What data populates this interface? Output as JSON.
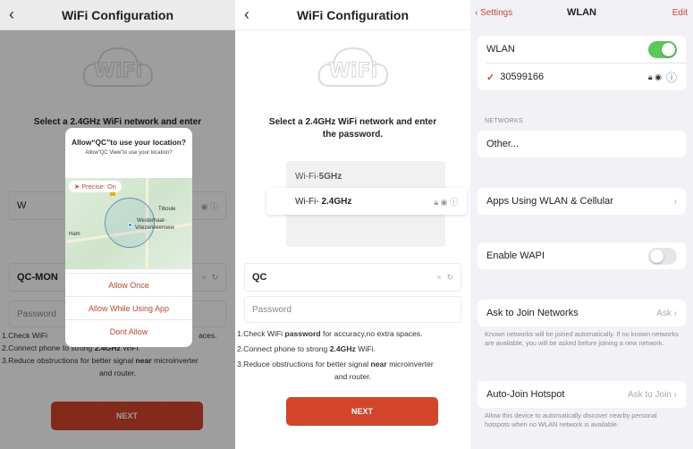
{
  "colors": {
    "accent": "#d3452b",
    "toggle_on": "#5ac85a",
    "ios_bg": "#f2f2f6"
  },
  "screen1": {
    "title": "WiFi Configuration",
    "back": "‹",
    "instruction_visible": "Select a 2.4GHz WiFi network and enter",
    "dialog": {
      "title": "Allow“QC”to use your location?",
      "subtitle": "Allow“QC View”to use your location?",
      "precise": "➤ Precise: On",
      "map_labels": [
        "Tiboule",
        "Westerhaar-",
        "Vriezenveensew"
      ],
      "map_label_left": "Ham",
      "btn_once": "Allow Once",
      "btn_while": "Allow While Using App",
      "btn_deny": "Dont Allow"
    },
    "ssid_partial": "W",
    "ssid_value": "QC-MON",
    "password_placeholder": "Password",
    "tip1_visible": "1.Check WiFi",
    "tip1_end": "aces.",
    "tip2_pre": "2.Connect phone to strong ",
    "tip2_bold": "2.4GHz",
    "tip2_post": " WiFi.",
    "tip3_pre": "3.Reduce obstructions for better signal ",
    "tip3_bold": "near",
    "tip3_post": " microinverter",
    "tip3_line2": "and router.",
    "next": "NEXT"
  },
  "screen2": {
    "title": "WiFi Configuration",
    "back": "‹",
    "logo": "WiFi",
    "instruction": "Select a 2.4GHz WiFi network and enter the password.",
    "wifi_5g": "Wi-Fi-5GHz",
    "wifi_24_prefix": "Wi-Fi- ",
    "wifi_24_bold": "2.4GHz",
    "ssid_value": "QC",
    "password_placeholder": "Password",
    "tip1_pre": "1.Check WiFi ",
    "tip1_bold": "password",
    "tip1_post": " for accuracy,no extra spaces.",
    "tip2_pre": "2.Connect phone to strong ",
    "tip2_bold": "2.4GHz",
    "tip2_post": " WiFi.",
    "tip3_pre": "3.Reduce obstructions for better signal ",
    "tip3_bold": "near",
    "tip3_post": " microinverter",
    "tip3_line2": "and router.",
    "next": "NEXT"
  },
  "screen3": {
    "back": "‹ Settings",
    "title": "WLAN",
    "edit": "Edit",
    "wlan_label": "WLAN",
    "connected_check": "✓",
    "connected_network": "30599166",
    "networks_header": "NETWORKS",
    "other": "Other...",
    "apps_wlan": "Apps Using WLAN & Cellular",
    "enable_wapi": "Enable WAPI",
    "ask_join": "Ask to Join Networks",
    "ask_join_value": "Ask",
    "ask_join_footer": "Known networks will be joined automatically. If no known networks are available, you will be asked before joining a new network.",
    "auto_join": "Auto-Join Hotspot",
    "auto_join_value": "Ask to Join",
    "auto_join_footer": "Allow this device to automatically discover nearby personal hotspots when no WLAN network is available."
  }
}
